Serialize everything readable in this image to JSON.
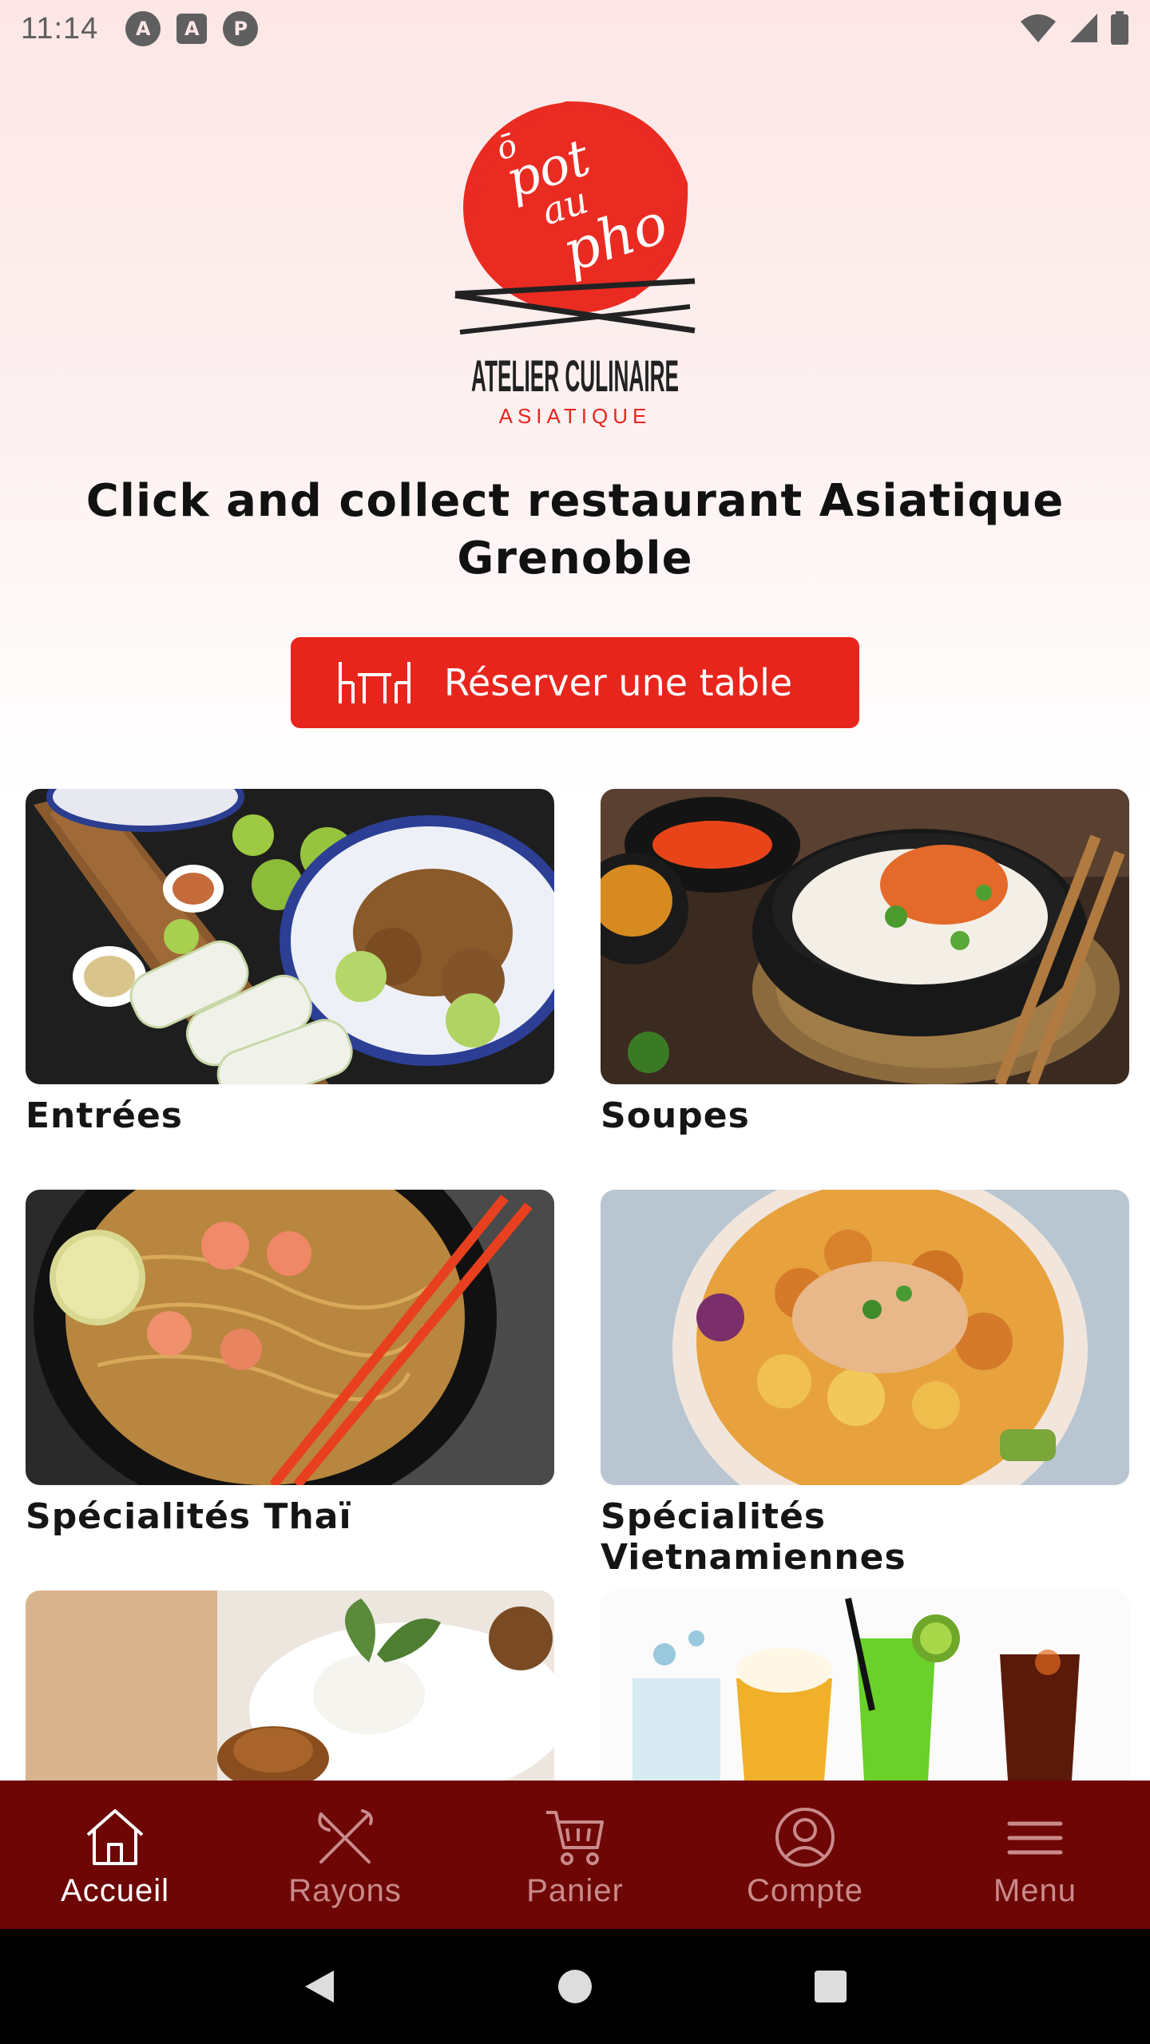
{
  "status_bar": {
    "time": "11:14",
    "left_icons": [
      "A",
      "A",
      "P"
    ]
  },
  "logo": {
    "script_text": "ô pot au pho",
    "line1": "ATELIER CULINAIRE",
    "line2": "ASIATIQUE"
  },
  "headline": "Click and collect restaurant Asiatique Grenoble",
  "reserve_button": {
    "label": "Réserver une table"
  },
  "categories": [
    {
      "label": "Entrées"
    },
    {
      "label": "Soupes"
    },
    {
      "label": "Spécialités Thaï"
    },
    {
      "label": "Spécialités Vietnamiennes"
    },
    {
      "label": ""
    },
    {
      "label": ""
    }
  ],
  "bottom_nav": [
    {
      "label": "Accueil",
      "icon": "home-icon",
      "active": true
    },
    {
      "label": "Rayons",
      "icon": "utensils-icon",
      "active": false
    },
    {
      "label": "Panier",
      "icon": "cart-icon",
      "active": false
    },
    {
      "label": "Compte",
      "icon": "account-icon",
      "active": false
    },
    {
      "label": "Menu",
      "icon": "hamburger-icon",
      "active": false
    }
  ],
  "colors": {
    "accent_red": "#e8251c",
    "nav_bg": "#6e0606",
    "background_top": "#fde6e6"
  }
}
